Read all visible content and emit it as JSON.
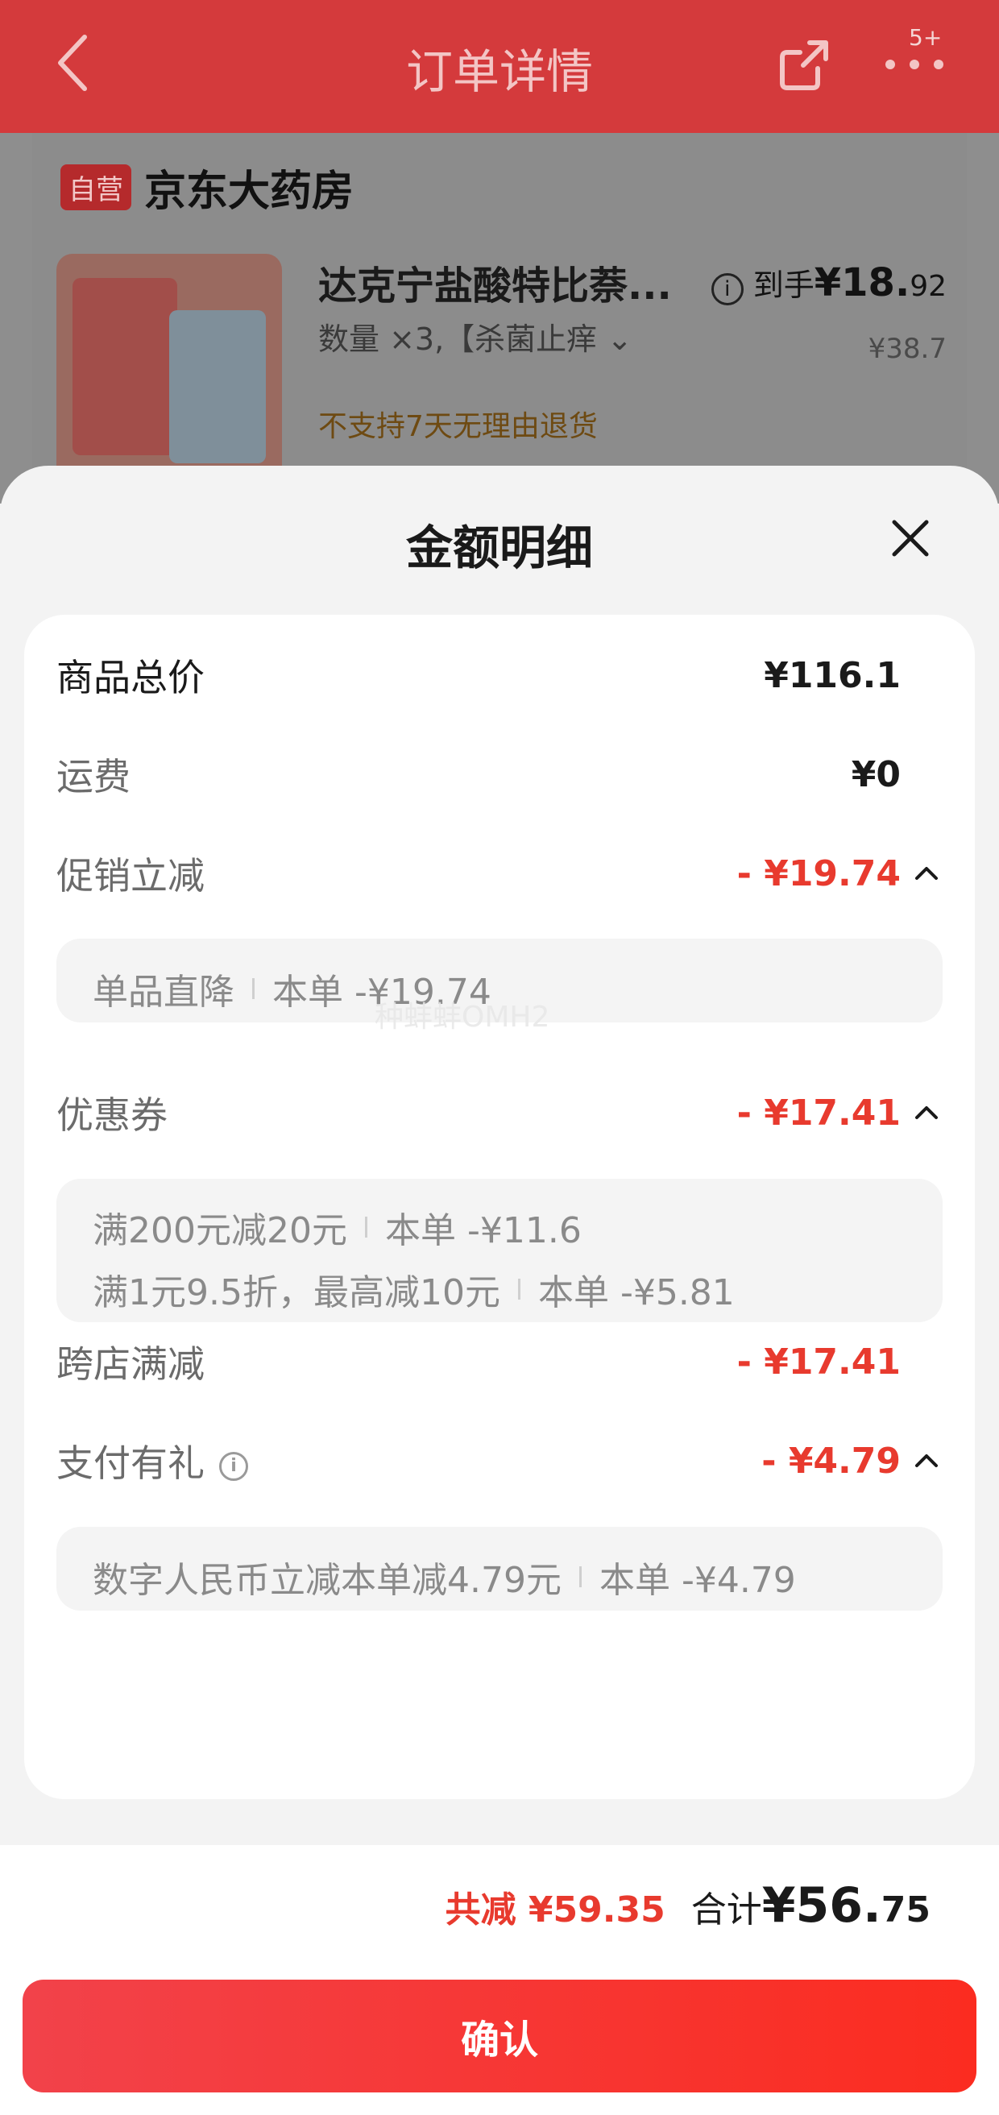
{
  "header": {
    "title": "订单详情",
    "more_badge": "5+"
  },
  "order": {
    "store_badge": "自营",
    "store_name": "京东大药房",
    "product_name": "达克宁盐酸特比萘...",
    "quantity_spec": "数量 ×3,【杀菌止痒 ⌄",
    "price_label": "到手",
    "price_big": "¥18.",
    "price_small": "92",
    "original_price": "¥38.7",
    "return_policy": "不支持7天无理由退货"
  },
  "sheet": {
    "title": "金额明细",
    "rows": {
      "goods_total": {
        "label": "商品总价",
        "value": "¥116.1"
      },
      "shipping": {
        "label": "运费",
        "value": "¥0"
      },
      "promo": {
        "label": "促销立减",
        "value": "- ¥19.74"
      },
      "coupon": {
        "label": "优惠券",
        "value": "- ¥17.41"
      },
      "cross_store": {
        "label": "跨店满减",
        "value": "- ¥17.41"
      },
      "payment_gift": {
        "label": "支付有礼",
        "value": "- ¥4.79"
      }
    },
    "promo_details": [
      {
        "name": "单品直降",
        "amount": "本单 -¥19.74"
      }
    ],
    "coupon_details": [
      {
        "name": "满200元减20元",
        "amount": "本单 -¥11.6"
      },
      {
        "name": "满1元9.5折，最高减10元",
        "amount": "本单 -¥5.81"
      }
    ],
    "payment_details": [
      {
        "name": "数字人民币立减本单减4.79元",
        "amount": "本单 -¥4.79"
      }
    ],
    "watermark": "种蚌蚌OMH2"
  },
  "footer": {
    "saved": "共减 ¥59.35",
    "total_label": "合计 ",
    "total_big": "¥56.",
    "total_small": "75",
    "confirm_label": "确认"
  },
  "colors": {
    "accent_red": "#e83a2e",
    "header_red": "#d43a3c",
    "confirm_gradient_start": "#f2424a",
    "confirm_gradient_end": "#fb2c20"
  }
}
